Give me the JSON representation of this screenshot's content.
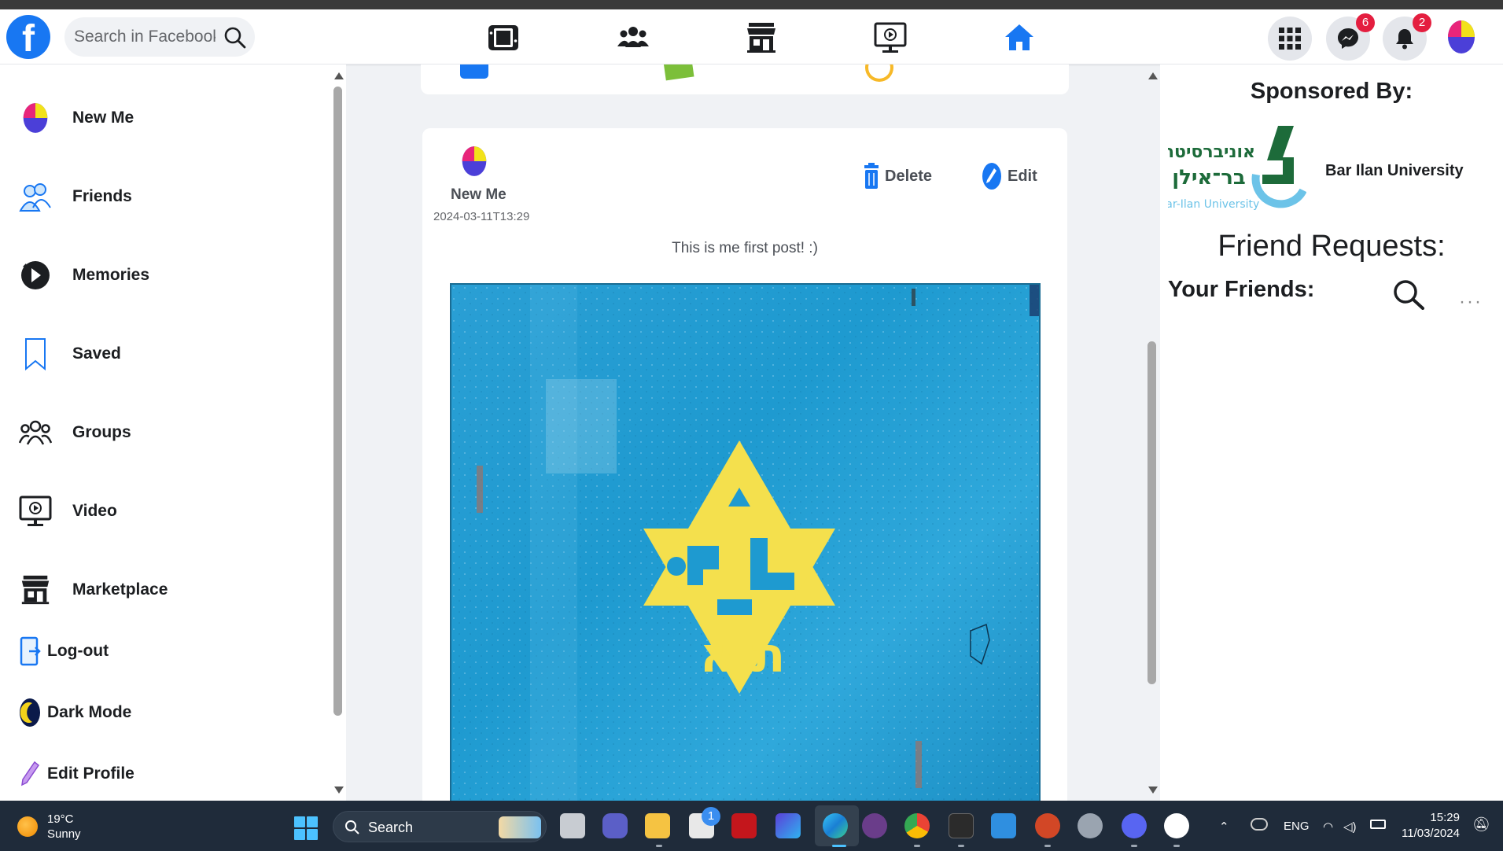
{
  "header": {
    "logo_letter": "f",
    "search_placeholder": "Search in Facebook",
    "messenger_badge": "6",
    "notifications_badge": "2"
  },
  "sidebar": {
    "items": [
      {
        "label": "New Me",
        "icon": "user-avatar"
      },
      {
        "label": "Friends",
        "icon": "friends-icon"
      },
      {
        "label": "Memories",
        "icon": "memories-icon"
      },
      {
        "label": "Saved",
        "icon": "bookmark-icon"
      },
      {
        "label": "Groups",
        "icon": "groups-icon"
      },
      {
        "label": "Video",
        "icon": "video-icon"
      },
      {
        "label": "Marketplace",
        "icon": "store-icon"
      },
      {
        "label": "Log-out",
        "icon": "logout-icon"
      },
      {
        "label": "Dark Mode",
        "icon": "moon-icon"
      },
      {
        "label": "Edit Profile",
        "icon": "pencil-icon"
      }
    ]
  },
  "post": {
    "author": "New Me",
    "timestamp": "2024-03-11T13:29",
    "text": "This is me first post! :)",
    "delete_label": "Delete",
    "edit_label": "Edit",
    "image_text_line1": "מכבי",
    "image_text_line2": "ת א"
  },
  "right": {
    "sponsored_title": "Sponsored By:",
    "sponsor_name": "Bar Ilan University",
    "sponsor_logo_hebrew_1": "אוניברסיטת",
    "sponsor_logo_hebrew_2": "בר־אילן",
    "sponsor_logo_english": "Bar-Ilan University",
    "friend_requests_title": "Friend Requests:",
    "your_friends_title": "Your Friends:",
    "more_label": "···"
  },
  "taskbar": {
    "temperature": "19°C",
    "weather": "Sunny",
    "search_label": "Search",
    "store_badge": "1",
    "language": "ENG",
    "time": "15:29",
    "date": "11/03/2024"
  },
  "colors": {
    "facebook_blue": "#1877f2",
    "badge_red": "#e41e3f",
    "taskbar_bg": "#1f2b3a",
    "post_image_blue": "#1e9ad0",
    "star_yellow": "#f4e04d"
  }
}
